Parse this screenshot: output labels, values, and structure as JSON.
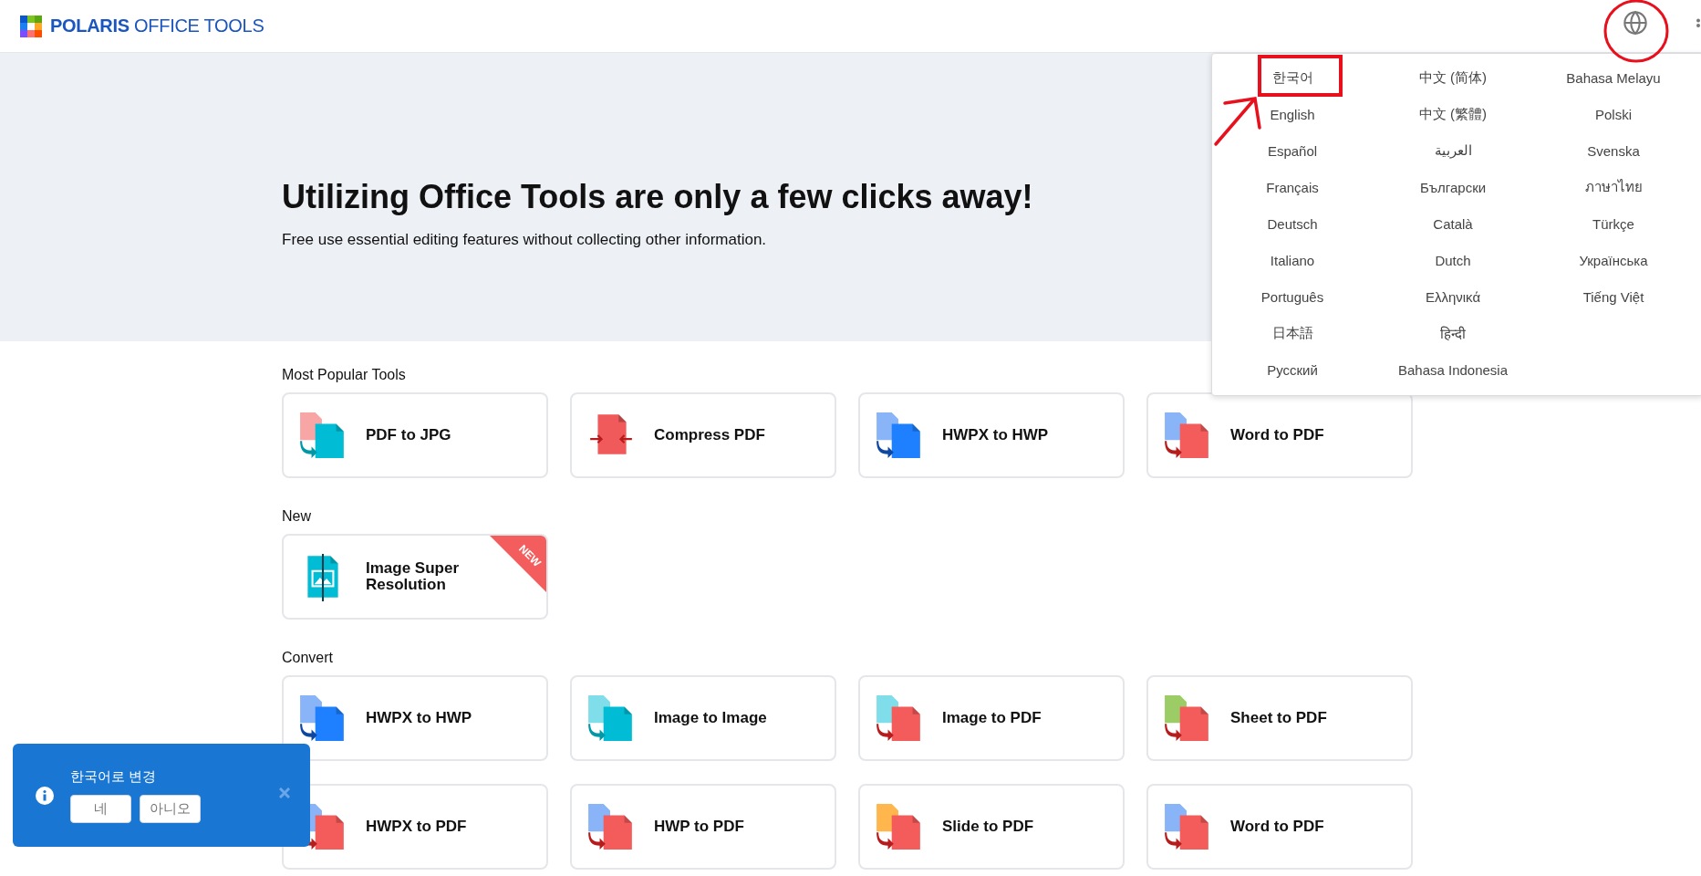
{
  "header": {
    "brand_bold": "POLARIS",
    "brand_light": "OFFICE TOOLS"
  },
  "hero": {
    "title": "Utilizing Office Tools are only a few clicks away!",
    "subtitle": "Free use essential editing features without collecting other information."
  },
  "sections": [
    {
      "title": "Most Popular Tools",
      "cards": [
        {
          "label": "PDF to JPG"
        },
        {
          "label": "Compress PDF"
        },
        {
          "label": "HWPX to HWP"
        },
        {
          "label": "Word to PDF"
        }
      ]
    },
    {
      "title": "New",
      "cards": [
        {
          "label": "Image Super Resolution",
          "badge": "NEW"
        }
      ]
    },
    {
      "title": "Convert",
      "cards": [
        {
          "label": "HWPX to HWP"
        },
        {
          "label": "Image to Image"
        },
        {
          "label": "Image to PDF"
        },
        {
          "label": "Sheet to PDF"
        },
        {
          "label": "HWPX to PDF"
        },
        {
          "label": "HWP to PDF"
        },
        {
          "label": "Slide to PDF"
        },
        {
          "label": "Word to PDF"
        }
      ]
    }
  ],
  "language_menu": [
    "한국어",
    "English",
    "Español",
    "Français",
    "Deutsch",
    "Italiano",
    "Português",
    "日本語",
    "Русский",
    "中文 (简体)",
    "中文 (繁體)",
    "العربية",
    "Български",
    "Català",
    "Dutch",
    "Ελληνικά",
    "हिन्दी",
    "Bahasa Indonesia",
    "Bahasa Melayu",
    "Polski",
    "Svenska",
    "ภาษาไทย",
    "Türkçe",
    "Українська",
    "Tiếng Việt"
  ],
  "toast": {
    "message": "한국어로 변경",
    "buttons": [
      "네",
      "아니오"
    ]
  }
}
